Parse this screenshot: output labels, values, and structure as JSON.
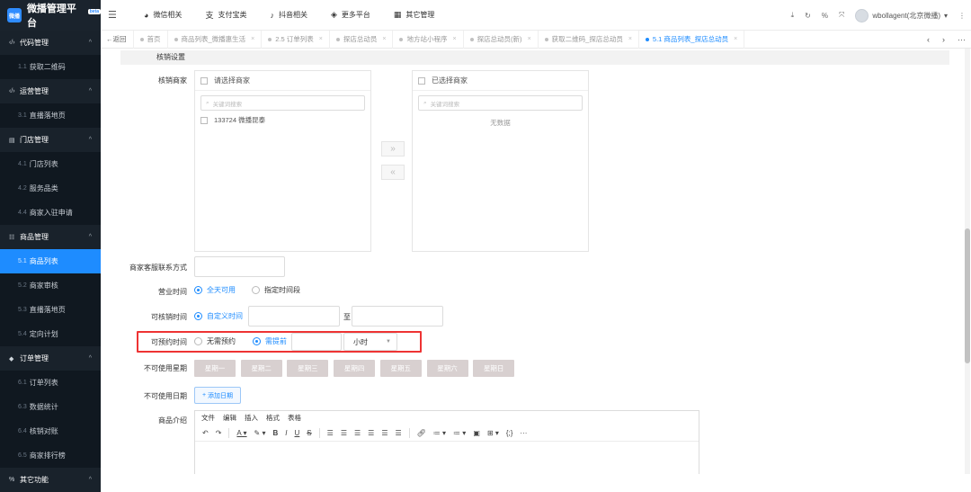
{
  "brand": {
    "title": "微播管理平台",
    "tag": "beta",
    "logo_text": "微播"
  },
  "sidebar": {
    "groups": [
      {
        "label": "代码管理",
        "icon": "code-icon",
        "items": [
          {
            "num": "1.1",
            "label": "获取二维码"
          }
        ]
      },
      {
        "label": "运营管理",
        "icon": "code-icon",
        "items": [
          {
            "num": "3.1",
            "label": "直播落地页"
          }
        ]
      },
      {
        "label": "门店管理",
        "icon": "store-icon",
        "items": [
          {
            "num": "4.1",
            "label": "门店列表"
          },
          {
            "num": "4.2",
            "label": "服务品类"
          },
          {
            "num": "4.4",
            "label": "商家入驻申请"
          }
        ]
      },
      {
        "label": "商品管理",
        "icon": "list-icon",
        "items": [
          {
            "num": "5.1",
            "label": "商品列表",
            "active": true
          },
          {
            "num": "5.2",
            "label": "商家审核"
          },
          {
            "num": "5.3",
            "label": "直播落地页"
          },
          {
            "num": "5.4",
            "label": "定向计划"
          }
        ]
      },
      {
        "label": "订单管理",
        "icon": "order-icon",
        "items": [
          {
            "num": "6.1",
            "label": "订单列表"
          },
          {
            "num": "6.3",
            "label": "数据统计"
          },
          {
            "num": "6.4",
            "label": "核销对账"
          },
          {
            "num": "6.5",
            "label": "商家排行榜"
          }
        ]
      },
      {
        "label": "其它功能",
        "icon": "link-icon",
        "items": []
      }
    ]
  },
  "topbar": {
    "menu": [
      {
        "label": "微信相关",
        "icon": "wechat-icon"
      },
      {
        "label": "支付宝类",
        "icon": "alipay-icon"
      },
      {
        "label": "抖音相关",
        "icon": "douyin-icon"
      },
      {
        "label": "更多平台",
        "icon": "layers-icon"
      },
      {
        "label": "其它管理",
        "icon": "grid-icon"
      }
    ],
    "user": "wbollagent(北京微播)"
  },
  "tabs": {
    "back": "返回",
    "items": [
      {
        "label": "首页",
        "closable": false
      },
      {
        "label": "商品列表_微播惠生活",
        "closable": true
      },
      {
        "label": "2.5 订单列表",
        "closable": true
      },
      {
        "label": "探店总动员",
        "closable": true
      },
      {
        "label": "地方站小程序",
        "closable": true
      },
      {
        "label": "探店总动员(新)",
        "closable": true
      },
      {
        "label": "获取二维码_探店总动员",
        "closable": true
      },
      {
        "label": "5.1 商品列表_探店总动员",
        "closable": true,
        "active": true
      }
    ]
  },
  "form": {
    "section_title": "核销设置",
    "merchant_label": "核销商家",
    "left_panel": {
      "title": "请选择商家",
      "search_placeholder": "关键词搜索",
      "items": [
        "133724 微播昆泰"
      ]
    },
    "right_panel": {
      "title": "已选择商家",
      "search_placeholder": "关键词搜索",
      "empty": "无数据"
    },
    "contact_label": "商家客服联系方式",
    "business_hours_label": "营业时间",
    "business_hours_options": [
      "全天可用",
      "指定时间段"
    ],
    "business_hours_selected": 0,
    "verify_time_label": "可核销时间",
    "verify_time_option": "自定义时间",
    "verify_time_to": "至",
    "reserve_label": "可预约时间",
    "reserve_options": [
      "无需预约",
      "需提前"
    ],
    "reserve_selected": 1,
    "reserve_unit": "小时",
    "weekday_label": "不可使用星期",
    "weekdays": [
      "星期一",
      "星期二",
      "星期三",
      "星期四",
      "星期五",
      "星期六",
      "星期日"
    ],
    "date_label": "不可使用日期",
    "add_date": "添加日期",
    "intro_label": "商品介绍",
    "editor_menu": [
      "文件",
      "编辑",
      "插入",
      "格式",
      "表格"
    ]
  },
  "colors": {
    "accent": "#1e8cff",
    "highlight": "#e33333",
    "sidebar": "#1f2a35"
  }
}
